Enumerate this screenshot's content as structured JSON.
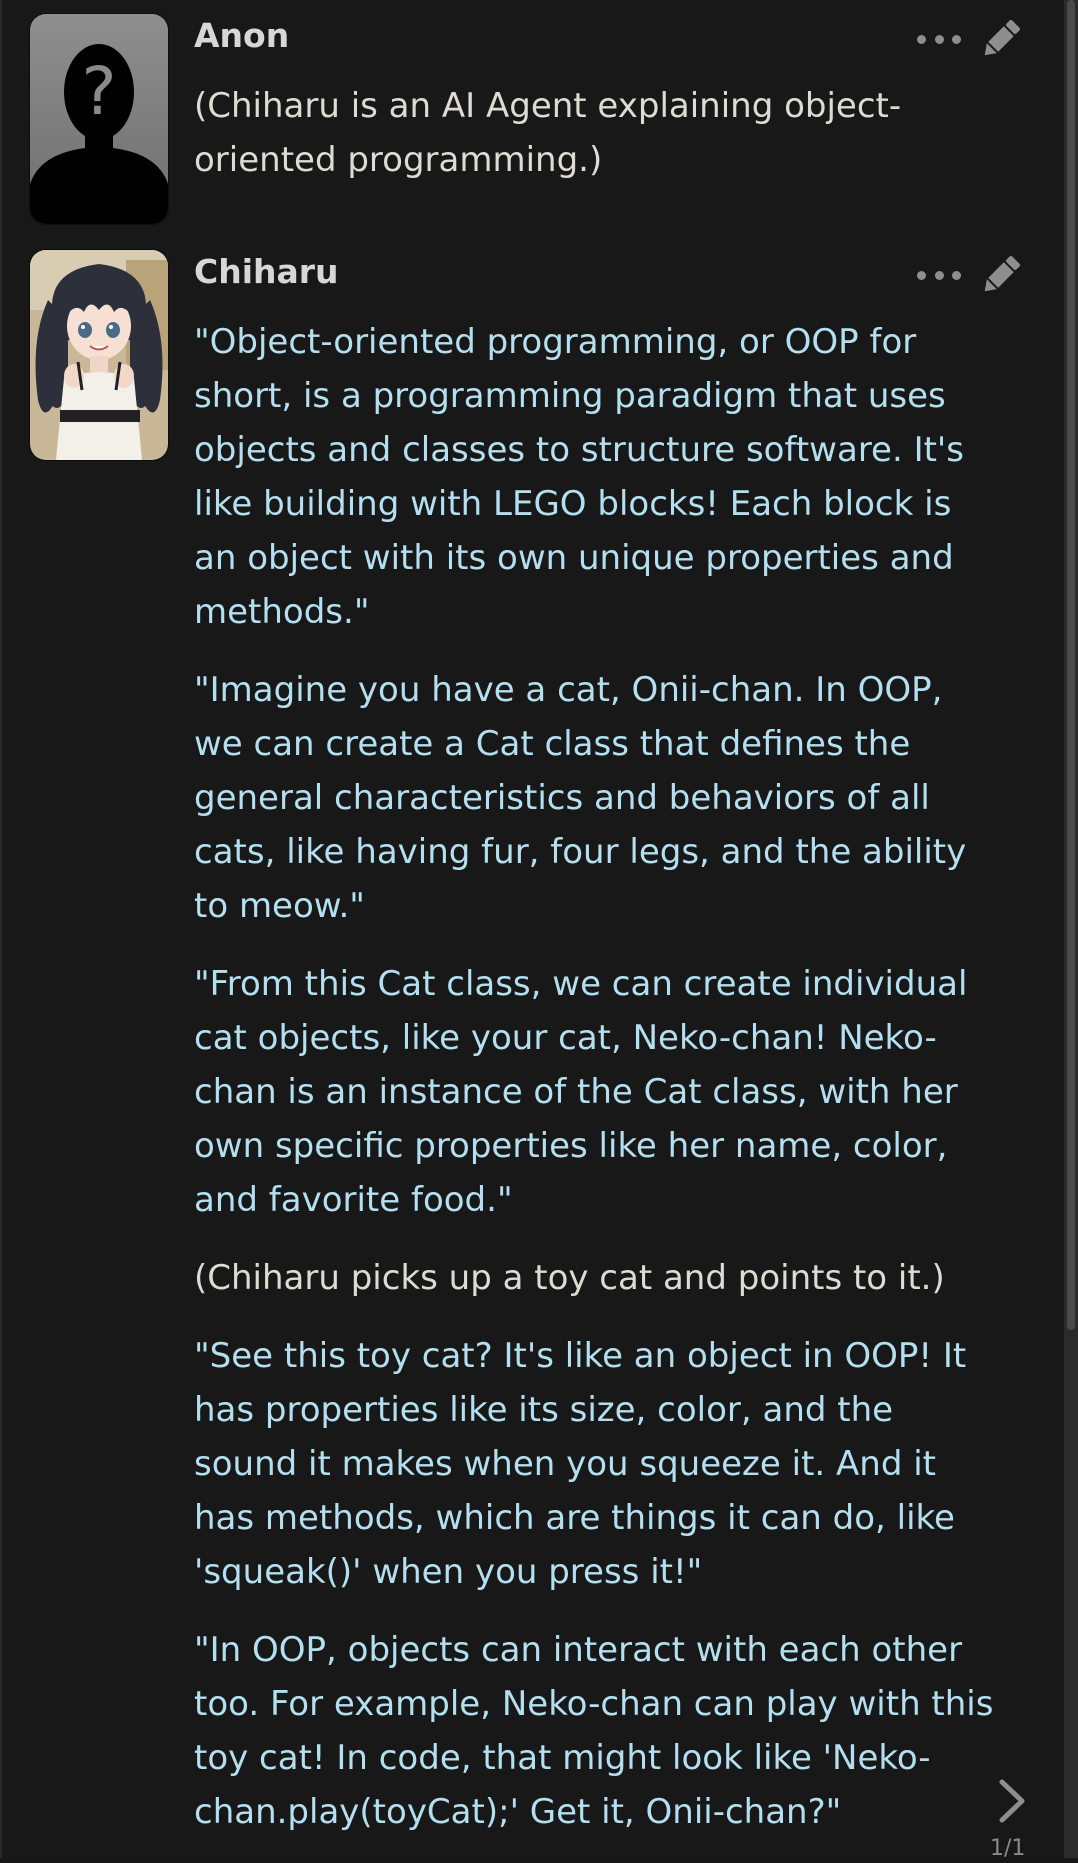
{
  "messages": [
    {
      "author": "Anon",
      "avatar_icon": "silhouette-question-avatar-icon",
      "paragraphs": [
        {
          "kind": "narr",
          "text": "(Chiharu is an AI Agent explaining object-oriented programming.)"
        }
      ]
    },
    {
      "author": "Chiharu",
      "avatar_icon": "anime-girl-avatar-icon",
      "paragraphs": [
        {
          "kind": "quote",
          "text": "\"Object-oriented programming, or OOP for short, is a programming paradigm that uses objects and classes to structure software. It's like building with LEGO blocks! Each block is an object with its own unique properties and methods.\""
        },
        {
          "kind": "quote",
          "text": "\"Imagine you have a cat, Onii-chan. In OOP, we can create a Cat class that defines the general characteristics and behaviors of all cats, like having fur, four legs, and the ability to meow.\""
        },
        {
          "kind": "quote",
          "text": "\"From this Cat class, we can create individual cat objects, like your cat, Neko-chan! Neko-chan is an instance of the Cat class, with her own specific properties like her name, color, and favorite food.\""
        },
        {
          "kind": "narr",
          "text": "(Chiharu picks up a toy cat and points to it.)"
        },
        {
          "kind": "quote",
          "text": "\"See this toy cat? It's like an object in OOP! It has properties like its size, color, and the sound it makes when you squeeze it. And it has methods, which are things it can do, like 'squeak()' when you press it!\""
        },
        {
          "kind": "quote",
          "text": "\"In OOP, objects can interact with each other too. For example, Neko-chan can play with this toy cat! In code, that might look like 'Neko-chan.play(toyCat);' Get it, Onii-chan?\""
        }
      ]
    }
  ],
  "swipe": {
    "counter": "1/1",
    "next_icon": "chevron-right-icon"
  },
  "icons": {
    "more": "more-options-icon",
    "edit": "pencil-icon"
  },
  "colors": {
    "background": "#181818",
    "author": "#d7d7d7",
    "narration": "#dcdcd2",
    "quote": "#b4dff0",
    "icon": "#8e8e8e"
  }
}
